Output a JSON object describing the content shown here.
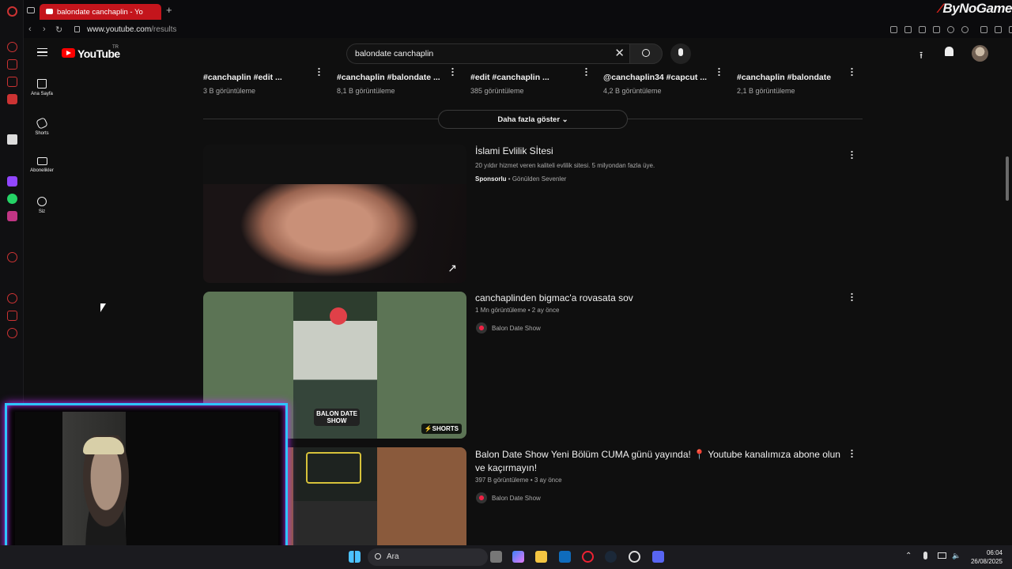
{
  "browser": {
    "tab_title": "balondate canchaplin - Yo",
    "new_tab": "+",
    "url_domain": "www.youtube.com",
    "url_path": "/results",
    "brand": "ByNoGame"
  },
  "youtube": {
    "logo_text": "YouTube",
    "country_code": "TR",
    "search": {
      "value": "balondate canchaplin"
    },
    "sidebar": [
      {
        "label": "Ana Sayfa",
        "icon": "home-icon"
      },
      {
        "label": "Shorts",
        "icon": "shorts-icon"
      },
      {
        "label": "Abonelikler",
        "icon": "subscriptions-icon"
      },
      {
        "label": "Siz",
        "icon": "you-icon"
      }
    ],
    "top_cards": [
      {
        "title": "#canchaplin #edit ...",
        "views": "3 B görüntüleme"
      },
      {
        "title": "#canchaplin #balondate ...",
        "views": "8,1 B görüntüleme"
      },
      {
        "title": "#edit #canchaplin ...",
        "views": "385 görüntüleme"
      },
      {
        "title": "@canchaplin34 #capcut ...",
        "views": "4,2 B görüntüleme"
      },
      {
        "title": "#canchaplin #balondate",
        "views": "2,1 B görüntüleme"
      }
    ],
    "show_more": "Daha fazla göster",
    "results": [
      {
        "title": "İslami Evlilik Sİtesi",
        "description": "20 yıldır hizmet veren kaliteli evlilik sitesi. 5 milyondan fazla üye.",
        "sponsored": "Sponsorlu",
        "advertiser": "Gönülden Sevenler"
      },
      {
        "title": "canchaplinden bigmac'a rovasata sov",
        "meta": "1 Mn görüntüleme • 2 ay önce",
        "channel": "Balon Date Show",
        "badge": "SHORTS",
        "thumb_text": "BALON DATE SHOW"
      },
      {
        "title": "Balon Date Show Yeni Bölüm CUMA günü yayında! 📍 Youtube kanalımıza abone olun ve kaçırmayın!",
        "meta": "397 B görüntüleme • 3 ay önce",
        "channel": "Balon Date Show"
      }
    ]
  },
  "taskbar": {
    "search_placeholder": "Ara",
    "time": "06:04",
    "date": "26/08/2025"
  },
  "colors": {
    "tab_active": "#c4151c",
    "yt_red": "#ff0000",
    "cam_border": "#2ec4ff",
    "cam_glow": "#c02cff"
  }
}
